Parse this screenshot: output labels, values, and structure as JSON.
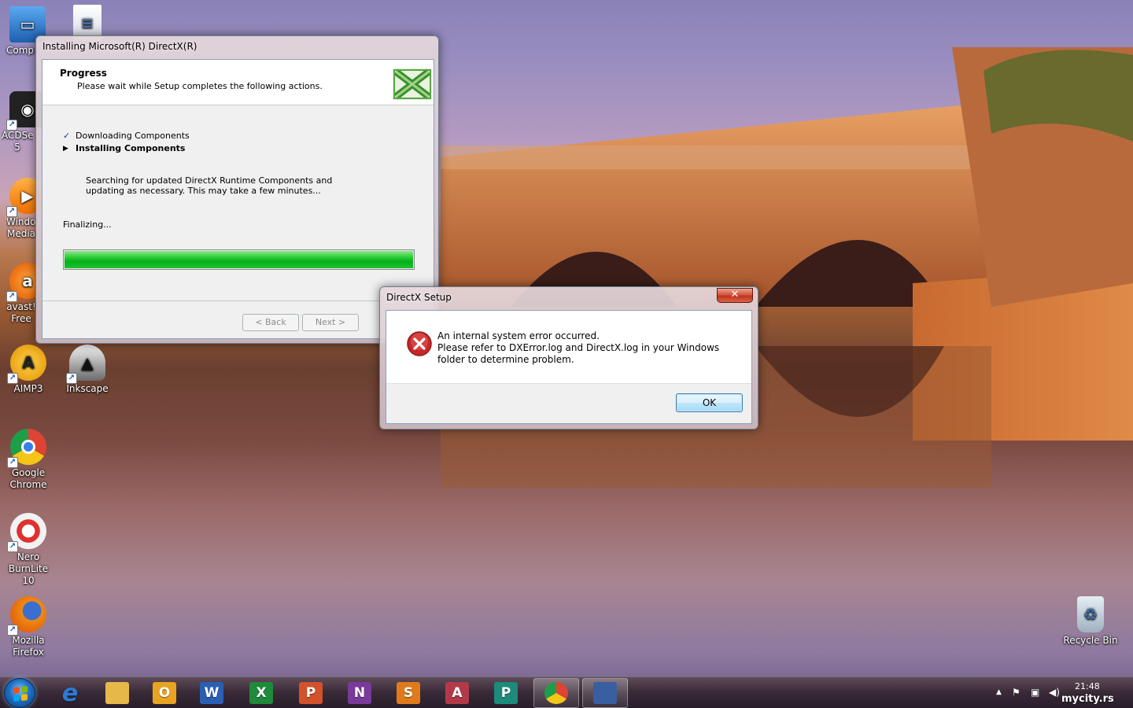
{
  "desktop": {
    "icons": [
      {
        "label": "Computer",
        "icon": "computer-icon"
      },
      {
        "label": "",
        "icon": "document-icon"
      },
      {
        "label": "ACDSee 5",
        "icon": "acdsee-icon"
      },
      {
        "label": "Windows Media Player",
        "icon": "media-player-icon"
      },
      {
        "label": "avast! Free Antivirus",
        "icon": "avast-icon"
      },
      {
        "label": "AIMP3",
        "icon": "aimp-icon"
      },
      {
        "label": "Inkscape",
        "icon": "inkscape-icon"
      },
      {
        "label": "Google Chrome",
        "icon": "chrome-icon"
      },
      {
        "label": "Nero BurnLite 10",
        "icon": "nero-icon"
      },
      {
        "label": "Mozilla Firefox",
        "icon": "firefox-icon"
      },
      {
        "label": "Recycle Bin",
        "icon": "recycle-bin-icon"
      }
    ]
  },
  "installer": {
    "title": "Installing Microsoft(R) DirectX(R)",
    "header_title": "Progress",
    "header_subtitle": "Please wait while Setup completes the following actions.",
    "steps": [
      {
        "label": "Downloading Components",
        "state": "done",
        "mark": "✓"
      },
      {
        "label": "Installing Components",
        "state": "active",
        "mark": "▶"
      }
    ],
    "description": "Searching for updated DirectX Runtime Components and updating as necessary. This may take a few minutes...",
    "status": "Finalizing...",
    "progress": 1.0,
    "progress_color": "#06b01a",
    "back_label": "< Back",
    "next_label": "Next >"
  },
  "error_dialog": {
    "title": "DirectX Setup",
    "close_glyph": "✕",
    "line1": "An internal system error occurred.",
    "line2": "Please refer to DXError.log and DirectX.log in your Windows folder to determine problem.",
    "ok_label": "OK",
    "icon": "error-icon",
    "icon_color": "#d32f2f"
  },
  "taskbar": {
    "apps": [
      {
        "name": "internet-explorer",
        "glyph": "e",
        "color": "#2b7bd6"
      },
      {
        "name": "windows-explorer",
        "glyph": "",
        "color": "#e6b84a"
      },
      {
        "name": "outlook",
        "glyph": "O",
        "color": "#e8a321"
      },
      {
        "name": "word",
        "glyph": "W",
        "color": "#2b5fb4"
      },
      {
        "name": "excel",
        "glyph": "X",
        "color": "#1f8a3a"
      },
      {
        "name": "powerpoint",
        "glyph": "P",
        "color": "#d2522a"
      },
      {
        "name": "onenote",
        "glyph": "N",
        "color": "#7a3a9a"
      },
      {
        "name": "sharepoint-workspace",
        "glyph": "S",
        "color": "#e07b1c"
      },
      {
        "name": "access",
        "glyph": "A",
        "color": "#b23a48"
      },
      {
        "name": "publisher",
        "glyph": "P",
        "color": "#1d8a7a"
      },
      {
        "name": "google-chrome",
        "glyph": "",
        "color": "#dd4433"
      },
      {
        "name": "directx-setup",
        "glyph": "",
        "color": "#3a5fa0"
      }
    ],
    "clock": "21:48",
    "watermark": "mycity.rs"
  }
}
